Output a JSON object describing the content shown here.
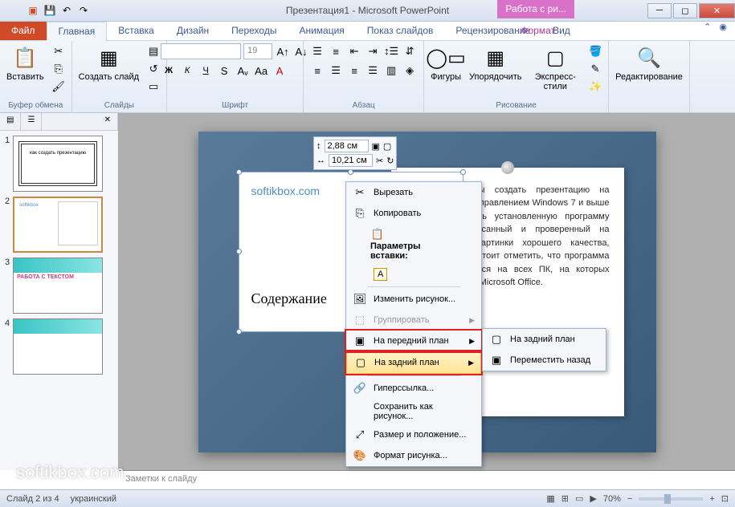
{
  "title": "Презентация1 - Microsoft PowerPoint",
  "tool_tab": "Работа с ри...",
  "tabs": {
    "file": "Файл",
    "home": "Главная",
    "insert": "Вставка",
    "design": "Дизайн",
    "transitions": "Переходы",
    "animations": "Анимация",
    "slideshow": "Показ слайдов",
    "review": "Рецензирование",
    "view": "Вид",
    "format": "Формат"
  },
  "ribbon": {
    "paste": "Вставить",
    "clipboard": "Буфер обмена",
    "newslide": "Создать слайд",
    "slides": "Слайды",
    "font": "Шрифт",
    "font_size": "19",
    "paragraph": "Абзац",
    "shapes": "Фигуры",
    "arrange": "Упорядочить",
    "styles": "Экспресс-стили",
    "drawing": "Рисование",
    "editing": "Редактирование"
  },
  "float": {
    "height": "2,88 см",
    "width": "10,21 см"
  },
  "context_menu": {
    "cut": "Вырезать",
    "copy": "Копировать",
    "paste_opts": "Параметры вставки:",
    "change_pic": "Изменить рисунок...",
    "group": "Группировать",
    "bring_front": "На передний план",
    "send_back": "На задний план",
    "hyperlink": "Гиперссылка...",
    "save_pic": "Сохранить как рисунок...",
    "size_pos": "Размер и положение...",
    "format_pic": "Формат рисунка..."
  },
  "submenu": {
    "send_back": "На задний план",
    "send_backward": "Переместить назад"
  },
  "slide_content": {
    "heading": "Содержание",
    "logo": "softikbox.com",
    "note_text": "Для того, чтобы создать презентацию на компьютере под управлением Windows 7 и выше необходимо иметь установленную программу PowerPoint, написанный и проверенный на ошибки текст, картинки хорошего качества, видеоматериал. Стоит отметить, что программа PowerPoint имеется на всех ПК, на которых установлен пакет Microsoft Office."
  },
  "thumbs": {
    "t1": "как создать презентацию",
    "t3": "РАБОТА С ТЕКСТОМ"
  },
  "notes": "Заметки к слайду",
  "status": {
    "slide": "Слайд 2 из 4",
    "lang": "украинский",
    "zoom": "70%"
  },
  "watermark": "softikbox.com"
}
